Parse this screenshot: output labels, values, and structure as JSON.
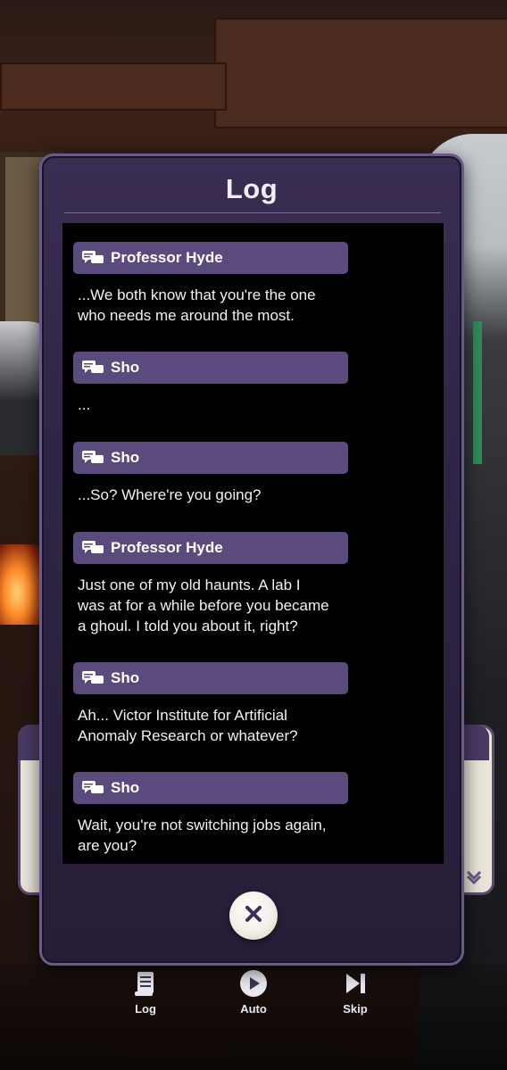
{
  "log_panel": {
    "title": "Log",
    "entries": [
      {
        "speaker": "Professor Hyde",
        "text": "...We both know that you're the one\nwho needs me around the most."
      },
      {
        "speaker": "Sho",
        "text": "..."
      },
      {
        "speaker": "Sho",
        "text": "...So? Where're you going?"
      },
      {
        "speaker": "Professor Hyde",
        "text": "Just one of my old haunts. A lab I\nwas at for a while before you became\na ghoul. I told you about it, right?"
      },
      {
        "speaker": "Sho",
        "text": "Ah... Victor Institute for Artificial\nAnomaly Research or whatever?"
      },
      {
        "speaker": "Sho",
        "text": "Wait, you're not switching jobs again,\nare you?"
      }
    ],
    "close_icon": "close-x-icon"
  },
  "bottom_menu": {
    "log_label": "Log",
    "auto_label": "Auto",
    "skip_label": "Skip"
  },
  "colors": {
    "accent": "#5b4b7c",
    "panel": "#2f2445"
  }
}
